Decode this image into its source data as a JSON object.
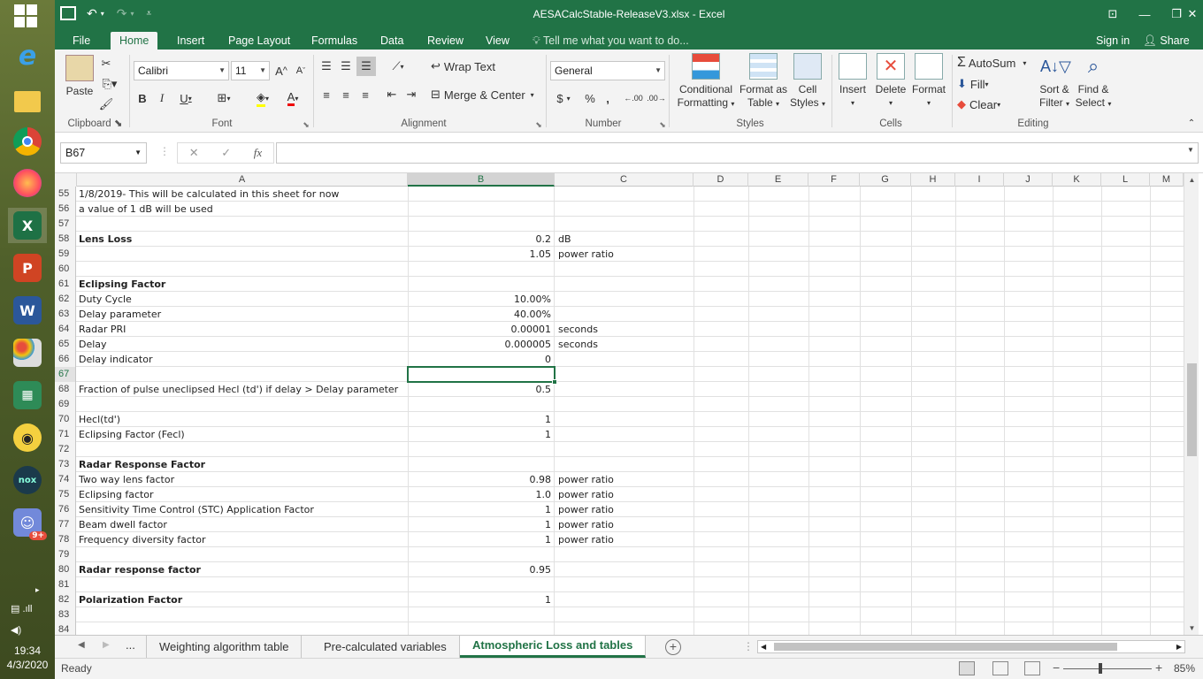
{
  "window": {
    "title": "AESACalcStable-ReleaseV3.xlsx - Excel",
    "accent": "#217346"
  },
  "qat": {
    "save_icon": "save-icon",
    "undo_icon": "undo-icon",
    "redo_icon": "redo-icon"
  },
  "tabs": [
    "File",
    "Home",
    "Insert",
    "Page Layout",
    "Formulas",
    "Data",
    "Review",
    "View"
  ],
  "active_tab": "Home",
  "tell_me": "Tell me what you want to do...",
  "sign_in": "Sign in",
  "share": "Share",
  "ribbon": {
    "clipboard": {
      "paste": "Paste",
      "label": "Clipboard"
    },
    "font": {
      "name": "Calibri",
      "size": "11",
      "label": "Font",
      "bold": "B",
      "italic": "I",
      "underline": "U",
      "grow": "A",
      "shrink": "A"
    },
    "alignment": {
      "wrap": "Wrap Text",
      "merge": "Merge & Center",
      "label": "Alignment"
    },
    "number": {
      "format": "General",
      "label": "Number",
      "currency": "$",
      "percent": "%",
      "comma": ",",
      "inc_dec": ".00",
      "dec_dec": ".00"
    },
    "styles": {
      "conditional": [
        "Conditional",
        "Formatting"
      ],
      "format_table": [
        "Format as",
        "Table"
      ],
      "cell_styles": [
        "Cell",
        "Styles"
      ],
      "label": "Styles"
    },
    "cells": {
      "insert": "Insert",
      "delete": "Delete",
      "format": "Format",
      "label": "Cells"
    },
    "editing": {
      "autosum": "AutoSum",
      "fill": "Fill",
      "clear": "Clear",
      "sort": [
        "Sort &",
        "Filter"
      ],
      "find": [
        "Find &",
        "Select"
      ],
      "label": "Editing"
    }
  },
  "name_box": "B67",
  "fx_label": "fx",
  "columns": [
    "A",
    "B",
    "C",
    "D",
    "E",
    "F",
    "G",
    "H",
    "I",
    "J",
    "K",
    "L",
    "M"
  ],
  "selected_column": "B",
  "selected_row": "67",
  "rows": [
    {
      "n": "55",
      "a": "1/8/2019- This will be calculated  in this sheet for now",
      "b": "",
      "c": "",
      "bold": false
    },
    {
      "n": "56",
      "a": "a value of 1 dB will be used",
      "b": "",
      "c": "",
      "bold": false
    },
    {
      "n": "57",
      "a": "",
      "b": "",
      "c": "",
      "bold": false
    },
    {
      "n": "58",
      "a": "Lens Loss",
      "b": "0.2",
      "c": "dB",
      "bold": true
    },
    {
      "n": "59",
      "a": "",
      "b": "1.05",
      "c": "power ratio",
      "bold": false
    },
    {
      "n": "60",
      "a": "",
      "b": "",
      "c": "",
      "bold": false
    },
    {
      "n": "61",
      "a": "Eclipsing Factor",
      "b": "",
      "c": "",
      "bold": true
    },
    {
      "n": "62",
      "a": "Duty Cycle",
      "b": "10.00%",
      "c": "",
      "bold": false
    },
    {
      "n": "63",
      "a": "Delay parameter",
      "b": "40.00%",
      "c": "",
      "bold": false
    },
    {
      "n": "64",
      "a": "Radar PRI",
      "b": "0.00001",
      "c": "seconds",
      "bold": false
    },
    {
      "n": "65",
      "a": "Delay",
      "b": "0.000005",
      "c": "seconds",
      "bold": false
    },
    {
      "n": "66",
      "a": "Delay indicator",
      "b": "0",
      "c": "",
      "bold": false
    },
    {
      "n": "67",
      "a": "",
      "b": "",
      "c": "",
      "bold": false
    },
    {
      "n": "68",
      "a": "Fraction of pulse uneclipsed Hecl (td') if delay > Delay parameter",
      "b": "0.5",
      "c": "",
      "bold": false
    },
    {
      "n": "69",
      "a": "",
      "b": "",
      "c": "",
      "bold": false
    },
    {
      "n": "70",
      "a": "Hecl(td')",
      "b": "1",
      "c": "",
      "bold": false
    },
    {
      "n": "71",
      "a": "Eclipsing Factor (Fecl)",
      "b": "1",
      "c": "",
      "bold": false
    },
    {
      "n": "72",
      "a": "",
      "b": "",
      "c": "",
      "bold": false
    },
    {
      "n": "73",
      "a": "Radar Response Factor",
      "b": "",
      "c": "",
      "bold": true
    },
    {
      "n": "74",
      "a": "Two way lens factor",
      "b": "0.98",
      "c": "power ratio",
      "bold": false
    },
    {
      "n": "75",
      "a": "Eclipsing factor",
      "b": "1.0",
      "c": "power ratio",
      "bold": false
    },
    {
      "n": "76",
      "a": "Sensitivity Time Control (STC) Application Factor",
      "b": "1",
      "c": "power ratio",
      "bold": false
    },
    {
      "n": "77",
      "a": "Beam dwell factor",
      "b": "1",
      "c": "power ratio",
      "bold": false
    },
    {
      "n": "78",
      "a": "Frequency diversity factor",
      "b": "1",
      "c": "power ratio",
      "bold": false
    },
    {
      "n": "79",
      "a": "",
      "b": "",
      "c": "",
      "bold": false
    },
    {
      "n": "80",
      "a": "Radar response factor",
      "b": "0.95",
      "c": "",
      "bold": true
    },
    {
      "n": "81",
      "a": "",
      "b": "",
      "c": "",
      "bold": false
    },
    {
      "n": "82",
      "a": "Polarization Factor",
      "b": "1",
      "c": "",
      "bold": true
    },
    {
      "n": "83",
      "a": "",
      "b": "",
      "c": "",
      "bold": false
    },
    {
      "n": "84",
      "a": "",
      "b": "",
      "c": "",
      "bold": false
    }
  ],
  "sheet_tabs": [
    "Weighting algorithm table",
    "Pre-calculated variables",
    "Atmospheric Loss and tables"
  ],
  "active_sheet": "Atmospheric Loss and tables",
  "sheet_ellipsis": "...",
  "status": "Ready",
  "zoom": "85%",
  "taskbar": {
    "time": "19:34",
    "date": "4/3/2020",
    "apps": [
      "internet-explorer-icon",
      "file-explorer-icon",
      "chrome-icon",
      "firefox-icon",
      "excel-icon",
      "powerpoint-icon",
      "word-icon",
      "paint-icon",
      "calculator-icon",
      "eye-app-icon",
      "nox-icon",
      "discord-icon"
    ],
    "discord_badge": "9+",
    "nox_label": "nox"
  }
}
